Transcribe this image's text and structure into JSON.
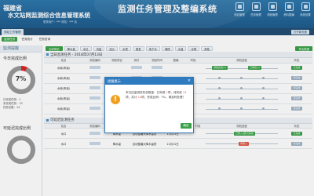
{
  "header": {
    "province": "福建省",
    "system_name": "水文站网监测综合信息管理系统",
    "main_title": "监测任务管理及整编系统",
    "info": "登录用户：***  测站：*** 站",
    "nav": [
      {
        "label": "测站管理",
        "icon": "station-icon"
      },
      {
        "label": "任务管理",
        "icon": "task-icon"
      },
      {
        "label": "测验管理",
        "icon": "survey-icon"
      },
      {
        "label": "资料整编",
        "icon": "compile-icon"
      },
      {
        "label": "系统设置",
        "icon": "settings-icon"
      }
    ]
  },
  "tabbar": {
    "tab": "测站工作管理",
    "button": "打开新页面"
  },
  "subtabs": [
    "监测任务",
    "任务统计",
    "任务查询"
  ],
  "toolbar": {
    "buttons": [
      "全部测站",
      "降水量",
      "水位",
      "流量",
      "泥沙",
      "水质",
      "蒸发",
      "地下水",
      "墒情",
      "水温",
      "冰情",
      "其他"
    ],
    "export": "导出数据"
  },
  "sidebar": {
    "header": "监测提醒",
    "today": {
      "title": "今日完成比例",
      "percent": "7%",
      "percent_value": 7,
      "line1": "已完成任务：1",
      "line2": "未完成任务：13",
      "line3": "任务总数：14"
    },
    "yesterday": {
      "title": "可延迟完成比例",
      "percent": "0%",
      "percent_value": 0
    }
  },
  "today_section": {
    "title": "当日监测任务 - 2018年07月13日",
    "columns": [
      "站名",
      "测站编码",
      "测验项目",
      "测次",
      "测验时间",
      "整编",
      "时段",
      "测验进度",
      "状态"
    ],
    "rows": [
      {
        "station": "水南(禾溪)",
        "code": "",
        "item": "",
        "count": "",
        "time": "",
        "edit": "",
        "period": "",
        "pill1": "测验完成(1)",
        "pill2": "已审核(1)",
        "status": "已完成"
      },
      {
        "station": "水南(禾溪)",
        "code": "",
        "item": "降水量",
        "count": "",
        "time": "",
        "edit": "",
        "period": "",
        "pill1": "",
        "pill2": "",
        "status": "待完成"
      },
      {
        "station": "水南(禾溪)",
        "code": "",
        "item": "降水量",
        "count": "",
        "time": "",
        "edit": "",
        "period": "",
        "pill1": "",
        "pill2": "",
        "status": "待完成"
      },
      {
        "station": "水南(禾溪)",
        "code": "",
        "item": "降水量",
        "count": "",
        "time": "",
        "edit": "",
        "period": "",
        "pill1": "",
        "pill2": "",
        "status": "待完成"
      },
      {
        "station": "水南(禾溪)",
        "code": "",
        "item": "降水量",
        "count": "",
        "time": "",
        "edit": "",
        "period": "",
        "pill1": "",
        "pill2": "",
        "status": "待完成"
      }
    ]
  },
  "delay_section": {
    "title": "可延迟监测任务",
    "columns": [
      "站名",
      "测站编码",
      "测验项目",
      "测次",
      "测验时间",
      "整编",
      "时段",
      "测验进度",
      "状态"
    ],
    "rows": [
      {
        "station": "水口",
        "code": "",
        "item": "降水量",
        "count": "自动整编大降水量表",
        "time": "12月31日",
        "pill": "已录入(部分完成)",
        "status": "已完成"
      },
      {
        "station": "水口",
        "code": "",
        "item": "降水量",
        "count": "自动整编大降水量表",
        "time": "12月31日",
        "pill": "待录入",
        "status": "待完成"
      }
    ]
  },
  "modal": {
    "title": "提醒提示",
    "close": "×",
    "msg_a": "本日应监测任务总数量：",
    "msg_b": "已完成",
    "done": "1",
    "msg_c": "项，待完成",
    "pending": "13",
    "msg_d": "项，共计",
    "total": "14",
    "msg_e": "项，完成比例：7%，请及时处理！",
    "ok": "确定"
  },
  "colors": {
    "header": "#1f5c8d",
    "accent_green": "#3aa148",
    "alert_red": "#e05a48",
    "warn_orange": "#f0a020"
  }
}
